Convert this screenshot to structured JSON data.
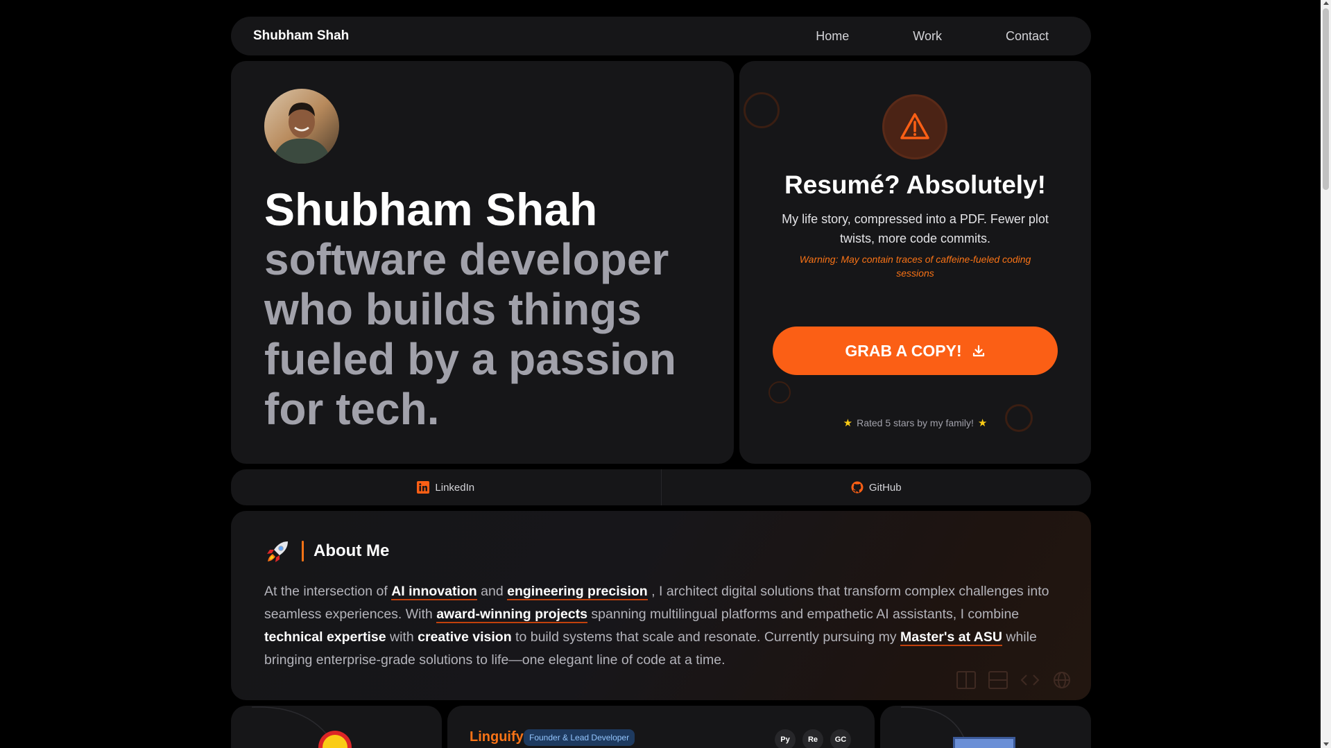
{
  "nav": {
    "brand": "Shubham Shah",
    "links": [
      "Home",
      "Work",
      "Contact"
    ]
  },
  "hero": {
    "name": "Shubham Shah",
    "tagline": "software developer who builds things fueled by a passion for tech."
  },
  "resume": {
    "title": "Resumé? Absolutely!",
    "subtitle": "My life story, compressed into a PDF. Fewer plot twists, more code commits.",
    "warning": "Warning: May contain traces of caffeine-fueled coding sessions",
    "button_label": "GRAB A COPY!",
    "rated": "Rated 5 stars by my family!",
    "accent": "#fb5f15"
  },
  "social": {
    "linkedin": "LinkedIn",
    "github": "GitHub"
  },
  "about": {
    "title": "About Me",
    "p1": "At the intersection of",
    "h1": "AI innovation",
    "p2": "and",
    "h2": "engineering precision",
    "p3": ", I architect digital solutions that transform complex challenges into seamless experiences. With",
    "h3": "award-winning projects",
    "p4": "spanning multilingual platforms and empathetic AI assistants, I combine",
    "b1": "technical expertise",
    "p5": "with",
    "b2": "creative vision",
    "p6": "to build systems that scale and resonate. Currently pursuing my",
    "h4": "Master's at ASU",
    "p7": "while bringing enterprise-grade solutions to life—one elegant line of code at a time."
  },
  "projects": {
    "linguify_title": "Linguify",
    "linguify_role": "Founder & Lead Developer",
    "tech": [
      "Py",
      "Re",
      "GC"
    ]
  }
}
